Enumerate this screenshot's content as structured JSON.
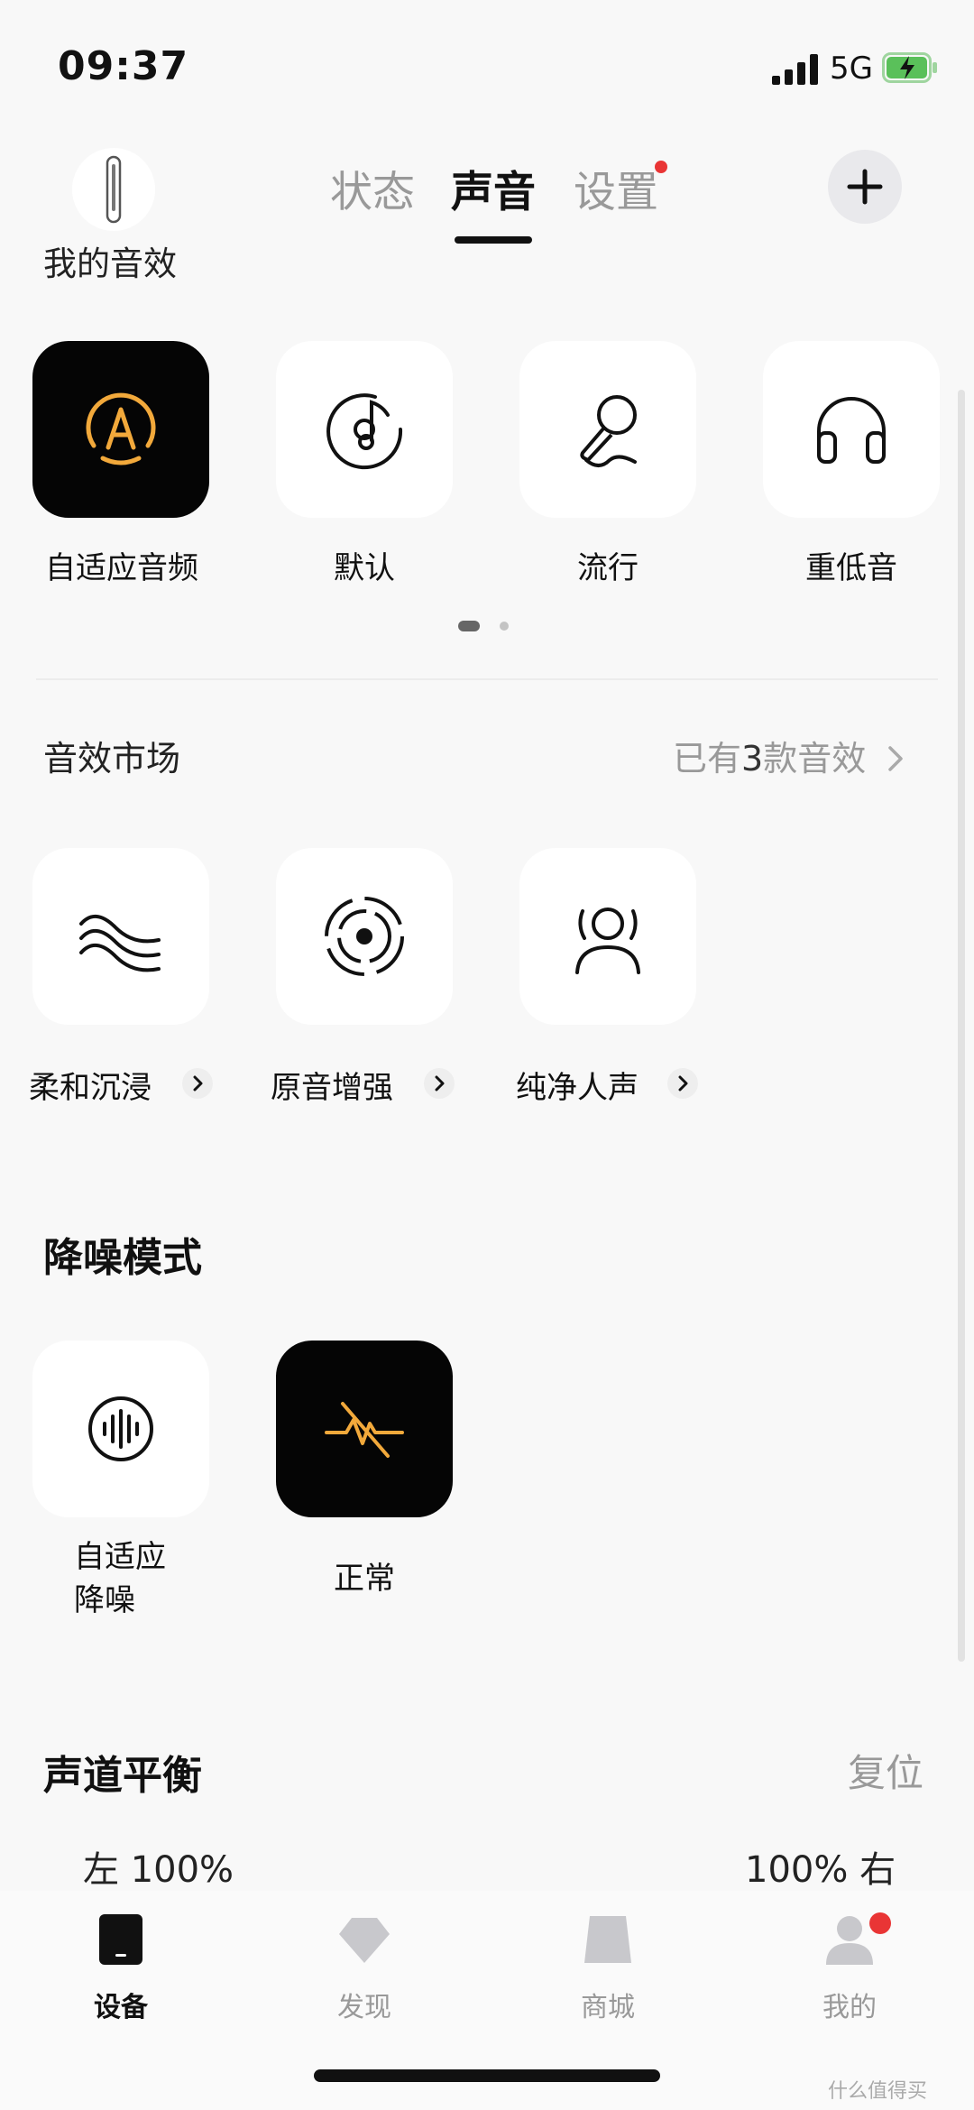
{
  "status_bar": {
    "time": "09:37",
    "network": "5G"
  },
  "header": {
    "my_effects_label": "我的音效",
    "tabs": [
      {
        "label": "状态",
        "active": false
      },
      {
        "label": "声音",
        "active": true
      },
      {
        "label": "设置",
        "active": false,
        "badge": true
      }
    ]
  },
  "presets": [
    {
      "label": "自适应音频",
      "icon": "adaptive-audio-icon",
      "selected": true
    },
    {
      "label": "默认",
      "icon": "music-disc-icon",
      "selected": false
    },
    {
      "label": "流行",
      "icon": "microphone-icon",
      "selected": false
    },
    {
      "label": "重低音",
      "icon": "headphones-icon",
      "selected": false
    }
  ],
  "presets_pager": {
    "pages": 2,
    "current": 1
  },
  "market": {
    "title": "音效市场",
    "summary_prefix": "已有",
    "summary_count": "3",
    "summary_suffix": "款音效",
    "items": [
      {
        "label": "柔和沉浸",
        "icon": "waves-icon"
      },
      {
        "label": "原音增强",
        "icon": "surround-icon"
      },
      {
        "label": "纯净人声",
        "icon": "person-voice-icon"
      }
    ]
  },
  "noise_control": {
    "title": "降噪模式",
    "modes": [
      {
        "label_line1": "自适应",
        "label_line2": "降噪",
        "icon": "waveform-circle-icon",
        "selected": false
      },
      {
        "label_line1": "正常",
        "label_line2": "",
        "icon": "normal-off-icon",
        "selected": true
      }
    ]
  },
  "balance": {
    "title": "声道平衡",
    "reset_label": "复位",
    "left_label": "左 100%",
    "right_label": "100% 右"
  },
  "bottom_nav": [
    {
      "label": "设备",
      "icon": "device-icon",
      "active": true
    },
    {
      "label": "发现",
      "icon": "diamond-icon",
      "active": false
    },
    {
      "label": "商城",
      "icon": "store-icon",
      "active": false
    },
    {
      "label": "我的",
      "icon": "profile-icon",
      "active": false,
      "badge": true
    }
  ],
  "watermark": "什么值得买",
  "colors": {
    "accent": "#f2a93b",
    "badge_red": "#e93535",
    "text_primary": "#111111",
    "text_secondary": "#999999"
  }
}
